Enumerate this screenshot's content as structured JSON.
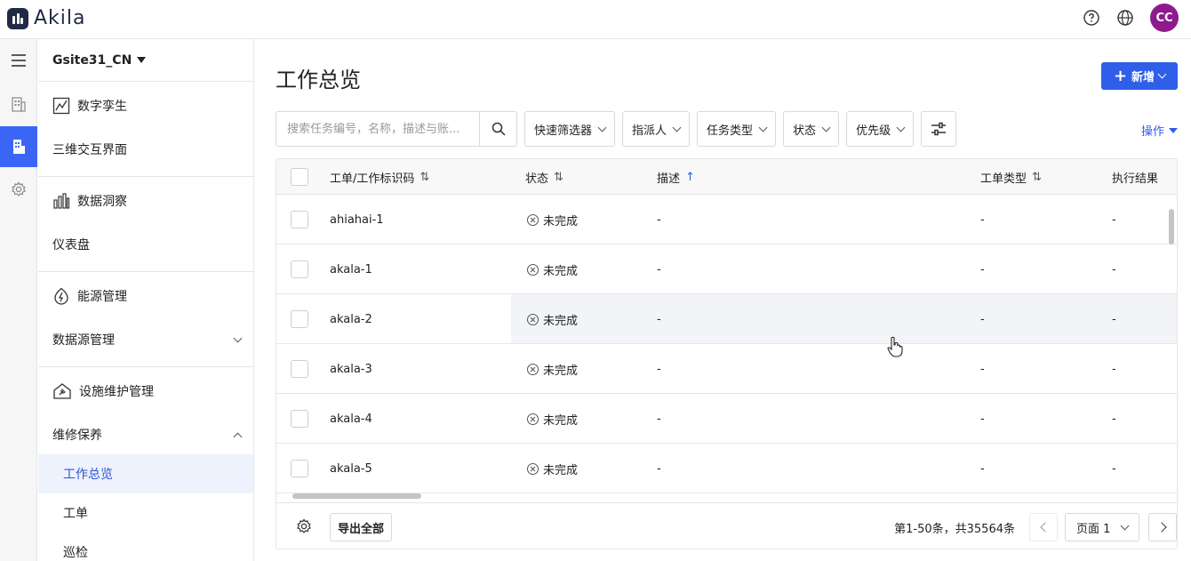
{
  "app": {
    "brand": "Akila",
    "avatar_initials": "CC",
    "avatar_color": "#8e1a8e",
    "accent": "#2f5fe8"
  },
  "topbar": {
    "icons": [
      "help-icon",
      "globe-icon"
    ]
  },
  "rail": {
    "items": [
      "menu-icon",
      "building-icon",
      "building-active-icon",
      "settings-icon"
    ]
  },
  "sidenav": {
    "site": "Gsite31_CN",
    "groups": [
      {
        "title": "数字孪生",
        "icon": "digital-twin-icon",
        "items": [
          {
            "label": "三维交互界面"
          }
        ]
      },
      {
        "title": "数据洞察",
        "icon": "bar-chart-icon",
        "items": [
          {
            "label": "仪表盘"
          }
        ]
      },
      {
        "title": "能源管理",
        "icon": "energy-icon",
        "items": [
          {
            "label": "数据源管理",
            "expand": "collapsed"
          }
        ]
      },
      {
        "title": "设施维护管理",
        "icon": "maintenance-icon",
        "items": [
          {
            "label": "维修保养",
            "expand": "expanded"
          },
          {
            "label": "工作总览",
            "active": true
          },
          {
            "label": "工单"
          },
          {
            "label": "巡检"
          }
        ]
      }
    ]
  },
  "main": {
    "title": "工作总览",
    "add_label": "新增",
    "search_placeholder": "搜索任务编号，名称，描述与账...",
    "filters": [
      "快速筛选器",
      "指派人",
      "任务类型",
      "状态",
      "优先级"
    ],
    "ops_label": "操作",
    "table": {
      "columns": [
        "工单/工作标识码",
        "状态",
        "描述",
        "工单类型",
        "执行结果"
      ],
      "rows": [
        {
          "id": "ahiahai-1",
          "status": "未完成",
          "desc": "-",
          "type": "-",
          "result": "-"
        },
        {
          "id": "akala-1",
          "status": "未完成",
          "desc": "-",
          "type": "-",
          "result": "-"
        },
        {
          "id": "akala-2",
          "status": "未完成",
          "desc": "-",
          "type": "-",
          "result": "-"
        },
        {
          "id": "akala-3",
          "status": "未完成",
          "desc": "-",
          "type": "-",
          "result": "-"
        },
        {
          "id": "akala-4",
          "status": "未完成",
          "desc": "-",
          "type": "-",
          "result": "-"
        },
        {
          "id": "akala-5",
          "status": "未完成",
          "desc": "-",
          "type": "-",
          "result": "-"
        }
      ]
    },
    "footer": {
      "export_label": "导出全部",
      "range_text": "第1-50条，共35564条",
      "page_label": "页面 1"
    }
  }
}
